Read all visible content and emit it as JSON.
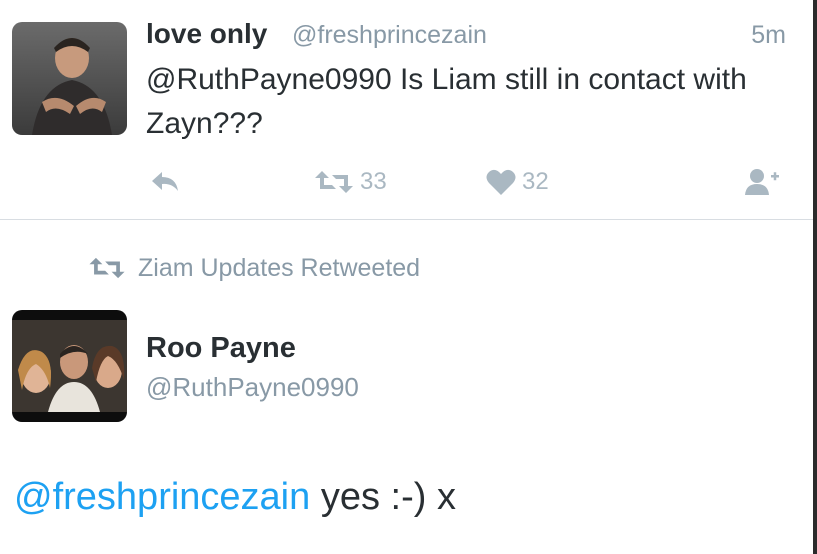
{
  "tweet1": {
    "avatar": "user-avatar-photo",
    "name": "love only",
    "handle": "@freshprincezain",
    "time": "5m",
    "text": "@RuthPayne0990 Is Liam still in contact with Zayn???",
    "actions": {
      "reply_icon": "reply-icon",
      "retweet_icon": "retweet-icon",
      "retweet_count": "33",
      "like_icon": "heart-icon",
      "like_count": "32",
      "follow_icon": "follow-user-icon"
    }
  },
  "retweet_context": {
    "icon": "retweet-icon",
    "label": "Ziam Updates Retweeted"
  },
  "tweet2": {
    "avatar": "user-avatar-photo",
    "name": "Roo Payne",
    "handle": "@RuthPayne0990",
    "mention": "@freshprincezain",
    "text": " yes :-) x"
  },
  "colors": {
    "link_blue": "#1da1f2",
    "secondary_text": "#8899a6",
    "icon_gray": "#aab8c2",
    "primary_text": "#292f33"
  }
}
